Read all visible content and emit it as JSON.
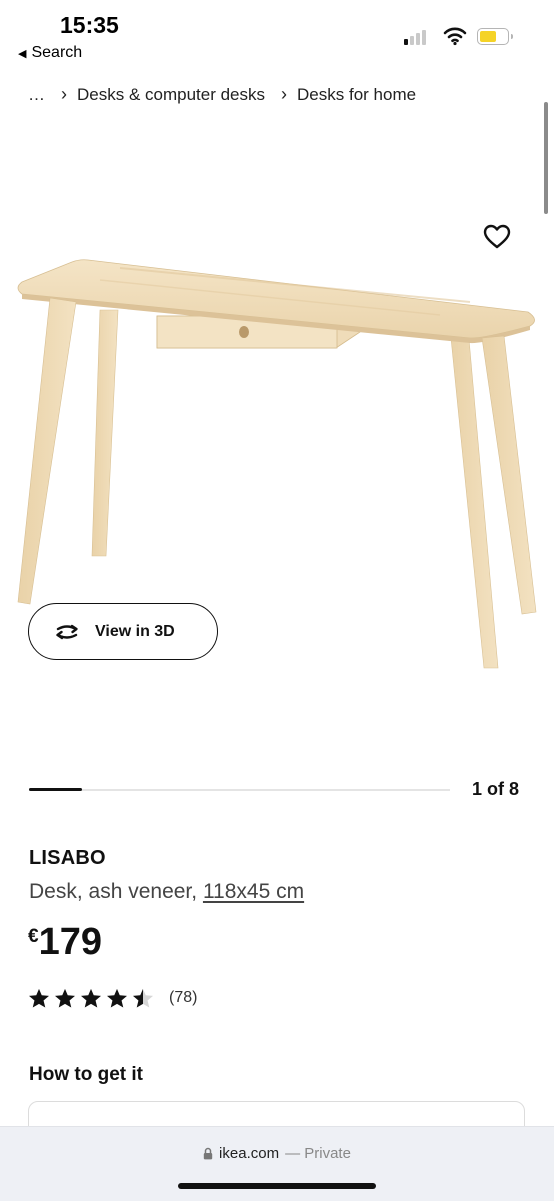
{
  "status_bar": {
    "time": "15:35",
    "back_label": "Search",
    "signal_bars_active": 1,
    "battery_color": "#f5d327",
    "battery_level": 0.6
  },
  "breadcrumb": {
    "ellipsis": "…",
    "items": [
      "Desks & computer desks",
      "Desks for home"
    ]
  },
  "gallery": {
    "view_3d_label": "View in 3D",
    "counter": "1 of 8",
    "current": 1,
    "total": 8
  },
  "product": {
    "name": "LISABO",
    "description": "Desk, ash veneer, ",
    "dimensions": "118x45 cm",
    "currency": "€",
    "price": "179",
    "rating": 4.5,
    "review_count": "(78)"
  },
  "sections": {
    "how_to_get": "How to get it"
  },
  "browser": {
    "domain": "ikea.com",
    "private_label": "— Private"
  },
  "colors": {
    "wood_light": "#f1dfbf",
    "wood_mid": "#e6cfa6",
    "wood_dark": "#d8bd91",
    "text": "#111111"
  },
  "icons": {
    "back": "back-triangle-icon",
    "favorite": "heart-outline-icon",
    "view3d": "rotate-3d-icon",
    "lock": "lock-icon"
  }
}
